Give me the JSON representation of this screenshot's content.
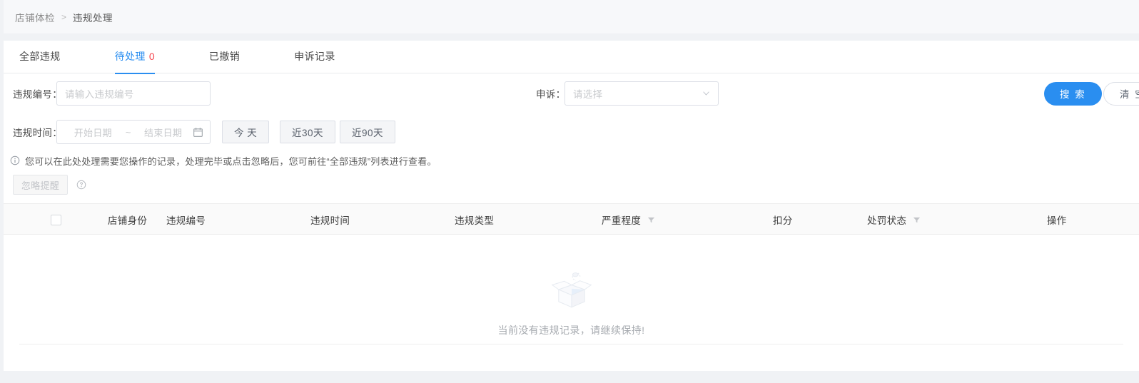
{
  "breadcrumb": {
    "items": [
      "店铺体检",
      "违规处理"
    ],
    "separator": ">"
  },
  "tabs": [
    {
      "label": "全部违规",
      "count": "",
      "active": false
    },
    {
      "label": "待处理",
      "count": "0",
      "active": true
    },
    {
      "label": "已撤销",
      "count": "",
      "active": false
    },
    {
      "label": "申诉记录",
      "count": "",
      "active": false
    }
  ],
  "filters": {
    "violation_no": {
      "label": "违规编号：",
      "placeholder": "请输入违规编号",
      "value": ""
    },
    "appeal": {
      "label": "申诉：",
      "placeholder": "请选择",
      "value": ""
    },
    "violation_time": {
      "label": "违规时间：",
      "start_placeholder": "开始日期",
      "separator": "~",
      "end_placeholder": "结束日期",
      "calendar_icon": "calendar-icon"
    },
    "quick_ranges": [
      "今 天",
      "近30天",
      "近90天"
    ],
    "search_label": "搜 索",
    "clear_label": "清 空"
  },
  "notice": {
    "icon": "info-circle-icon",
    "text": "您可以在此处处理需要您操作的记录，处理完毕或点击忽略后，您可前往“全部违规”列表进行查看。",
    "ignore_label": "忽略提醒",
    "help_icon": "question-circle-icon"
  },
  "table": {
    "select_all": "select-all-checkbox",
    "columns": [
      {
        "label": "店铺身份",
        "filterable": false
      },
      {
        "label": "违规编号",
        "filterable": false
      },
      {
        "label": "违规时间",
        "filterable": false
      },
      {
        "label": "违规类型",
        "filterable": false
      },
      {
        "label": "严重程度",
        "filterable": true
      },
      {
        "label": "扣分",
        "filterable": false
      },
      {
        "label": "处罚状态",
        "filterable": true
      },
      {
        "label": "操作",
        "filterable": false
      }
    ],
    "rows": [],
    "empty_text": "当前没有违规记录，请继续保持!",
    "empty_icon": "empty-box-icon"
  },
  "colors": {
    "accent": "#2a8ef0",
    "danger": "#f5424b",
    "page_bg": "#f0f2f5",
    "card_bg": "#ffffff",
    "header_bg": "#fafafa",
    "breadcrumb_bg": "#f7f8fa"
  }
}
